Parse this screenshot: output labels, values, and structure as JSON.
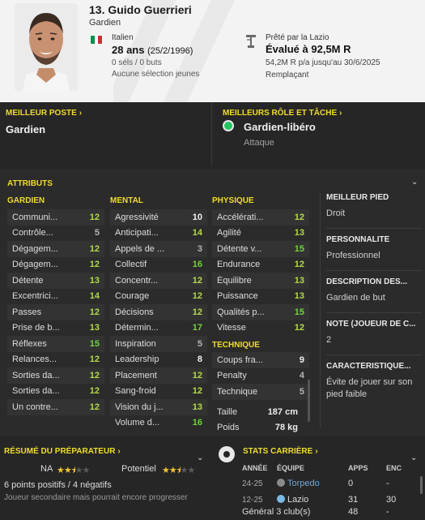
{
  "header": {
    "name": "13. Guido Guerrieri",
    "position": "Gardien",
    "nationality": "Italien",
    "age": "28 ans",
    "dob": "(25/2/1996)",
    "selections": "0 séls / 0 buts",
    "youth": "Aucune sélection jeunes",
    "loan": "Prêté par la Lazio",
    "value": "Évalué à 92,5M R",
    "wage": "54,2M R p/a jusqu'au 30/6/2025",
    "squad_status": "Remplaçant",
    "flag_colors": [
      "#009246",
      "#ffffff",
      "#ce2b37"
    ]
  },
  "best_position": {
    "title": "Meilleur poste",
    "value": "Gardien"
  },
  "best_role": {
    "title": "Meilleurs rôle et tâche",
    "role": "Gardien-libéro",
    "duty": "Attaque",
    "dot_color": "#22c55e"
  },
  "attributes": {
    "title": "Attributs",
    "gk_header": "Gardien",
    "mental_header": "Mental",
    "physical_header": "Physique",
    "technical_header": "Technique",
    "goalkeeping": [
      {
        "name": "Communi...",
        "value": "12"
      },
      {
        "name": "Contrôle...",
        "value": "5"
      },
      {
        "name": "Dégagem...",
        "value": "12"
      },
      {
        "name": "Dégagem...",
        "value": "12"
      },
      {
        "name": "Détente",
        "value": "13"
      },
      {
        "name": "Excentrici...",
        "value": "14"
      },
      {
        "name": "Passes",
        "value": "12"
      },
      {
        "name": "Prise de b...",
        "value": "13"
      },
      {
        "name": "Réflexes",
        "value": "15"
      },
      {
        "name": "Relances...",
        "value": "12"
      },
      {
        "name": "Sorties da...",
        "value": "12"
      },
      {
        "name": "Sorties da...",
        "value": "12"
      },
      {
        "name": "Un contre...",
        "value": "12"
      }
    ],
    "mental": [
      {
        "name": "Agressivité",
        "value": "10"
      },
      {
        "name": "Anticipati...",
        "value": "14"
      },
      {
        "name": "Appels de ...",
        "value": "3"
      },
      {
        "name": "Collectif",
        "value": "16"
      },
      {
        "name": "Concentr...",
        "value": "12"
      },
      {
        "name": "Courage",
        "value": "12"
      },
      {
        "name": "Décisions",
        "value": "12"
      },
      {
        "name": "Détermin...",
        "value": "17"
      },
      {
        "name": "Inspiration",
        "value": "5"
      },
      {
        "name": "Leadership",
        "value": "8"
      },
      {
        "name": "Placement",
        "value": "12"
      },
      {
        "name": "Sang-froid",
        "value": "12"
      },
      {
        "name": "Vision du j...",
        "value": "13"
      },
      {
        "name": "Volume d...",
        "value": "16"
      }
    ],
    "physical": [
      {
        "name": "Accélérati...",
        "value": "12"
      },
      {
        "name": "Agilité",
        "value": "13"
      },
      {
        "name": "Détente v...",
        "value": "15"
      },
      {
        "name": "Endurance",
        "value": "12"
      },
      {
        "name": "Équilibre",
        "value": "13"
      },
      {
        "name": "Puissance",
        "value": "13"
      },
      {
        "name": "Qualités p...",
        "value": "15"
      },
      {
        "name": "Vitesse",
        "value": "12"
      }
    ],
    "technical": [
      {
        "name": "Coups fra...",
        "value": "9"
      },
      {
        "name": "Penalty",
        "value": "4"
      },
      {
        "name": "Technique",
        "value": "5"
      }
    ],
    "height_label": "Taille",
    "height": "187 cm",
    "weight_label": "Poids",
    "weight": "78 kg",
    "colors": {
      "green": "#74d13f",
      "light_green": "#b3d94a",
      "white": "#f0f0f0",
      "grey": "#b4b4b4"
    }
  },
  "side": {
    "best_foot_label": "Meilleur pied",
    "best_foot": "Droit",
    "personality_label": "Personnalité",
    "personality": "Professionnel",
    "media_label": "Description des...",
    "media": "Gardien de but",
    "rating_label": "Note (joueur de c...",
    "rating": "2",
    "traits_label": "Caractéristique...",
    "traits": "Évite de jouer sur son pied faible"
  },
  "coach": {
    "title": "Résumé du préparateur",
    "na_label": "NA",
    "na_stars": "2.5",
    "potential_label": "Potentiel",
    "potential_stars": "2.5",
    "summary": "6 points positifs / 4 négatifs",
    "note": "Joueur secondaire mais pourrait encore progresser"
  },
  "career": {
    "title": "Stats carrière",
    "col_year": "Année",
    "col_team": "Équipe",
    "col_apps": "Apps",
    "col_gls": "Enc",
    "rows": [
      {
        "season": "24-25",
        "team": "Torpedo",
        "apps": "0",
        "gls": "-"
      },
      {
        "season": "12-25",
        "team": "Lazio",
        "apps": "31",
        "gls": "30"
      }
    ],
    "total_label": "Général 3 club(s)",
    "total_apps": "48",
    "total_gls": "-"
  }
}
